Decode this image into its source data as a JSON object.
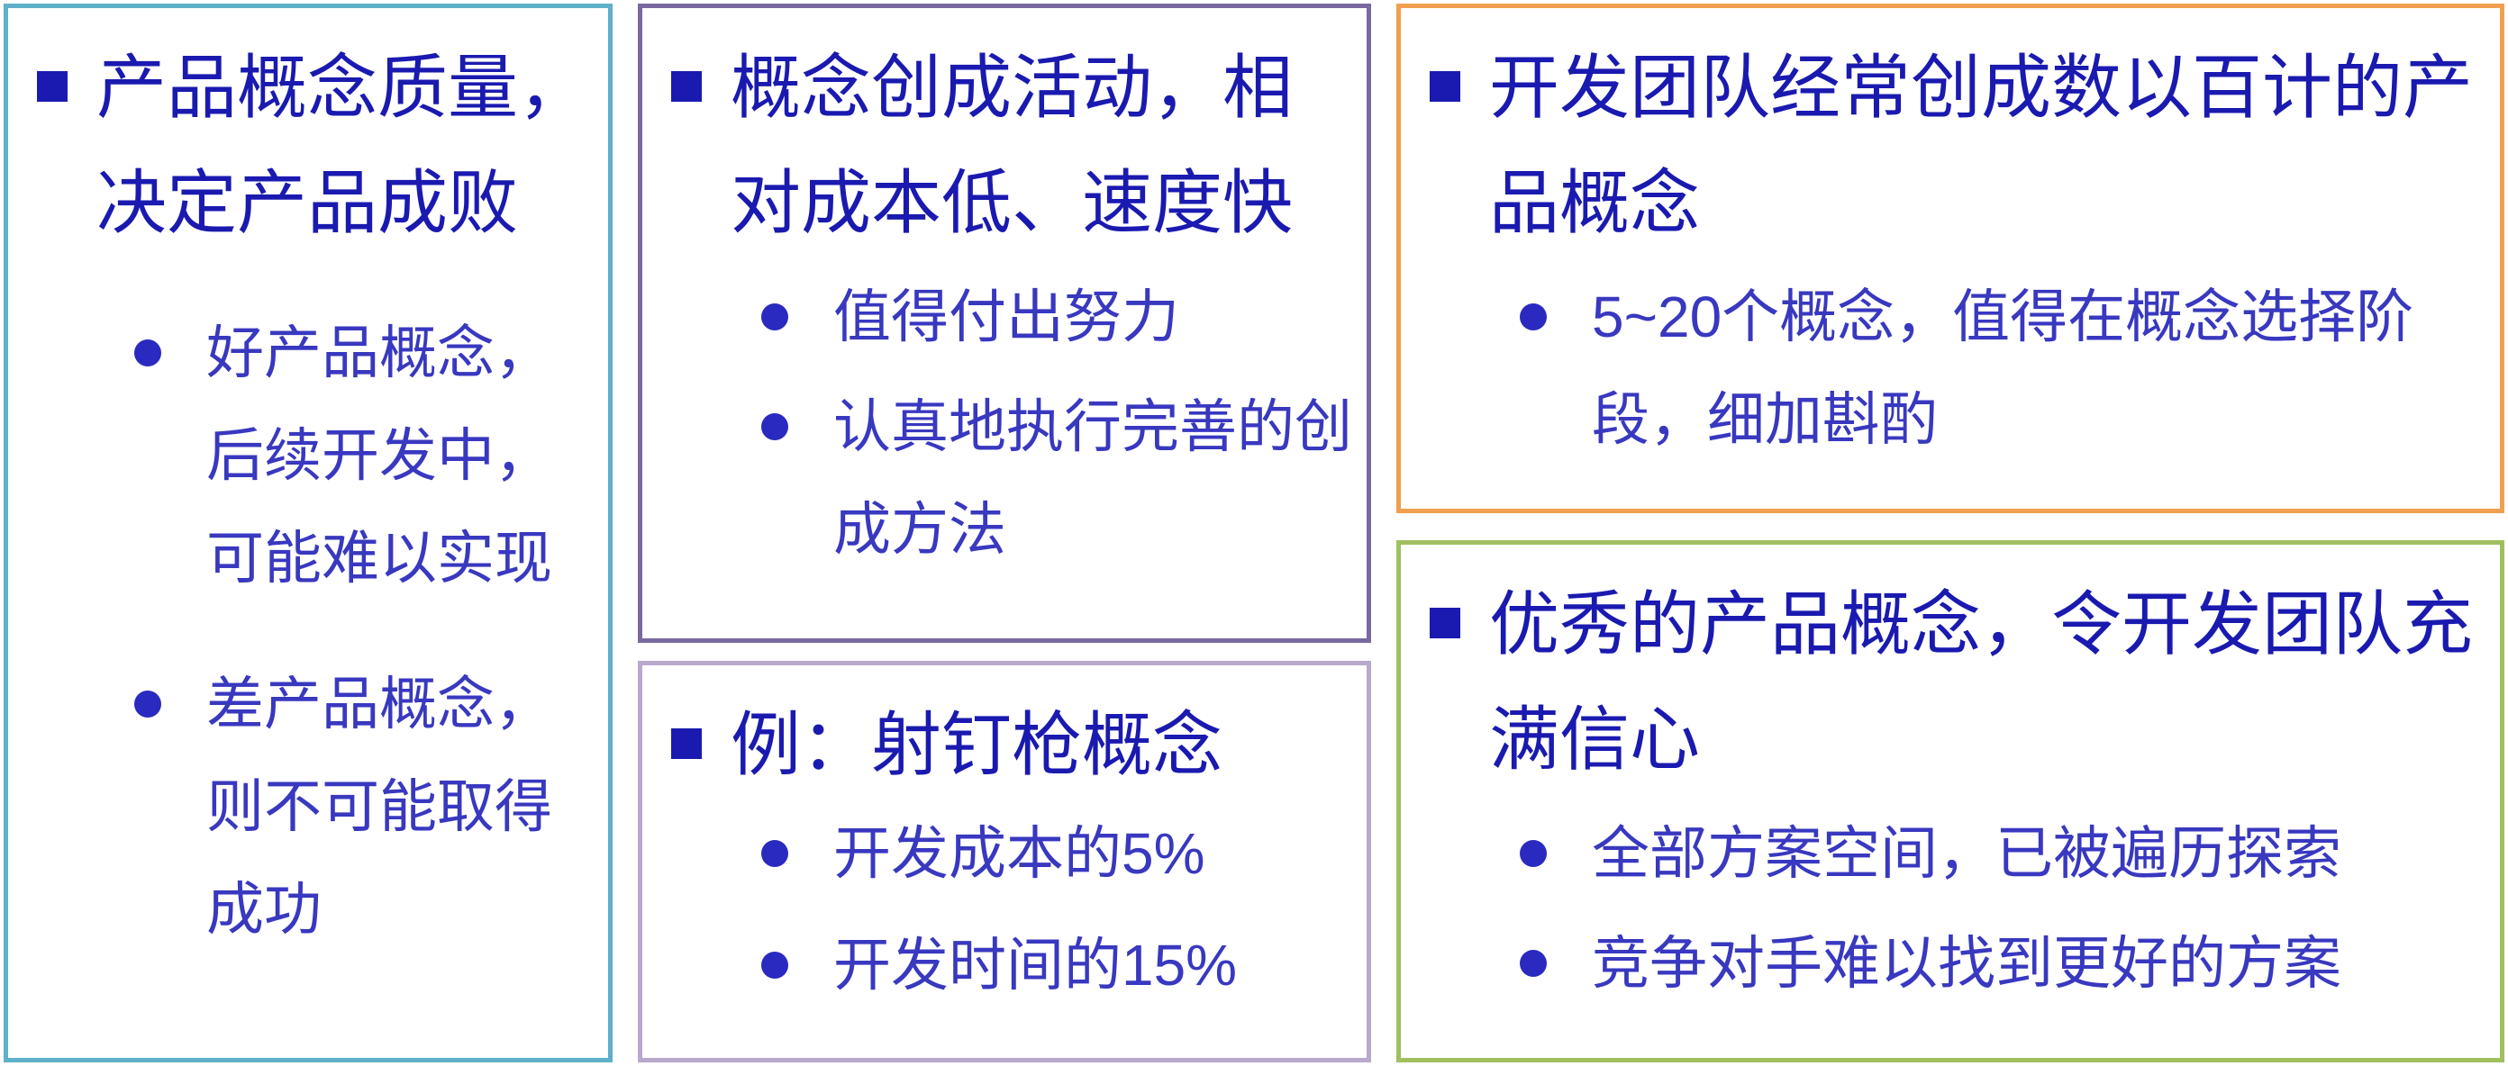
{
  "panels": {
    "quality": {
      "heading": "产品概念质量，决定产品成败",
      "bullets": [
        "好产品概念，后续开发中，可能难以实现",
        "差产品概念，则不可能取得成功"
      ]
    },
    "cost": {
      "heading": "概念创成活动，相对成本低、速度快",
      "bullets": [
        "值得付出努力",
        "认真地执行完善的创成方法"
      ]
    },
    "example": {
      "heading": "例：射钉枪概念",
      "bullets": [
        "开发成本的5%",
        "开发时间的15%"
      ]
    },
    "teams": {
      "heading": "开发团队经常创成数以百计的产品概念",
      "bullets": [
        "5~20个概念，值得在概念选择阶段，细加斟酌"
      ]
    },
    "great": {
      "heading": "优秀的产品概念，令开发团队充满信心",
      "bullets": [
        "全部方案空间，已被遍历探索",
        "竞争对手难以找到更好的方案"
      ]
    }
  },
  "colors": {
    "text": "#1a1ab0",
    "bullet_text": "#3838c0",
    "border_quality": "#5fb0c8",
    "border_cost": "#7a68a0",
    "border_example": "#b8a8cc",
    "border_teams": "#f0a050",
    "border_great": "#a0c060"
  }
}
